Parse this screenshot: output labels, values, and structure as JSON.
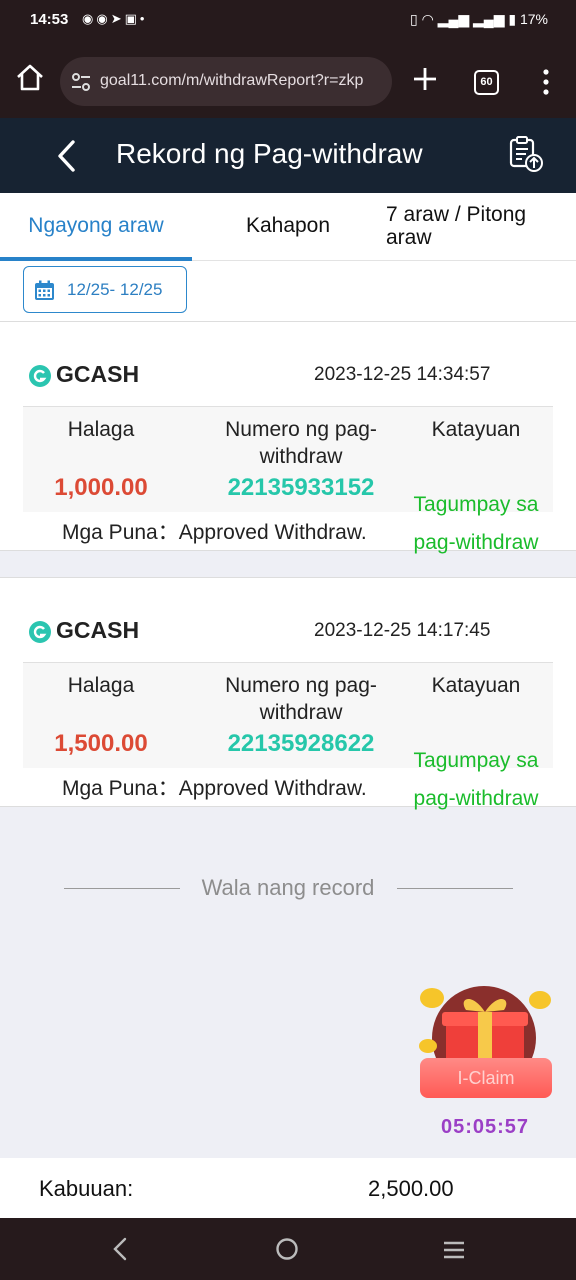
{
  "status_bar": {
    "time": "14:53",
    "battery": "17%",
    "notification_icons": [
      "messenger-icon",
      "messenger-icon",
      "telegram-icon",
      "game-icon",
      "dot-icon"
    ]
  },
  "browser": {
    "url": "goal11.com/m/withdrawReport?r=zkp",
    "tab_count": "60"
  },
  "header": {
    "title": "Rekord ng Pag-withdraw"
  },
  "tabs": [
    {
      "label": "Ngayong araw",
      "active": true
    },
    {
      "label": "Kahapon",
      "active": false
    },
    {
      "label": "7 araw / Pitong araw",
      "active": false
    }
  ],
  "date_filter": {
    "label": "12/25- 12/25"
  },
  "columns": {
    "amount": "Halaga",
    "number": "Numero ng pag-withdraw",
    "status": "Katayuan"
  },
  "records": [
    {
      "method": "GCASH",
      "timestamp": "2023-12-25 14:34:57",
      "amount": "1,000.00",
      "number": "22135933152",
      "status": "Tagumpay sa pag-withdraw",
      "remarks_label": "Mga Puna：",
      "remarks": "Approved Withdraw."
    },
    {
      "method": "GCASH",
      "timestamp": "2023-12-25 14:17:45",
      "amount": "1,500.00",
      "number": "22135928622",
      "status": "Tagumpay sa pag-withdraw",
      "remarks_label": "Mga Puna：",
      "remarks": "Approved Withdraw."
    }
  ],
  "end_message": "Wala nang record",
  "promo": {
    "label": "I-Claim",
    "timer": "05:05:57"
  },
  "total": {
    "label": "Kabuuan:",
    "value": "2,500.00"
  },
  "colors": {
    "accent": "#2882c9",
    "header_bg": "#172332",
    "amount": "#dc4a35",
    "number": "#26c7aa",
    "status": "#1bbc2c"
  }
}
